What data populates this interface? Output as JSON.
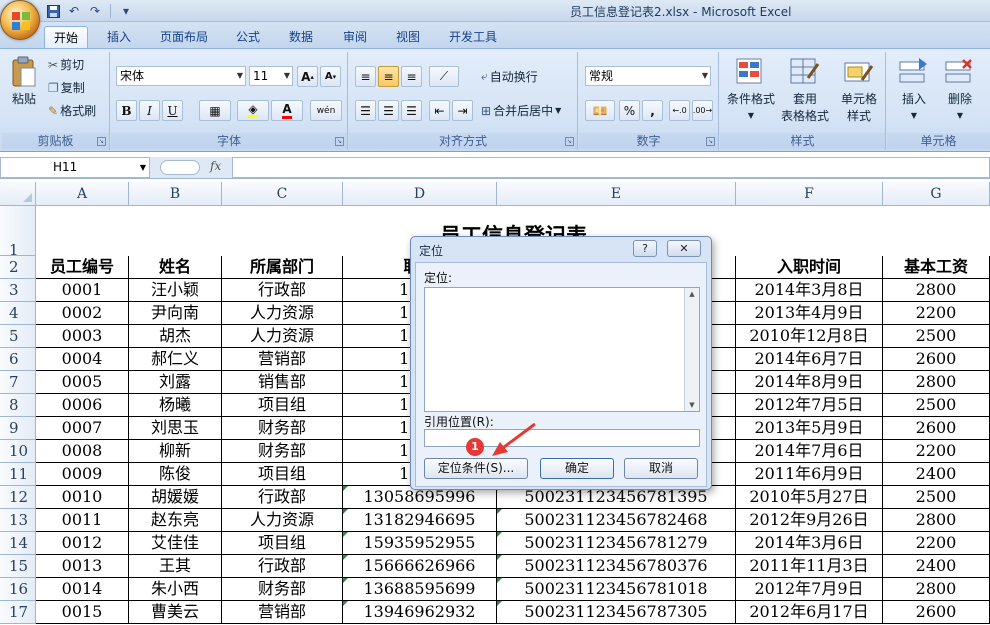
{
  "window": {
    "title": "员工信息登记表2.xlsx - Microsoft Excel"
  },
  "ribbon_tabs": [
    "开始",
    "插入",
    "页面布局",
    "公式",
    "数据",
    "审阅",
    "视图",
    "开发工具"
  ],
  "clipboard": {
    "paste": "粘贴",
    "cut": "剪切",
    "copy": "复制",
    "format_painter": "格式刷",
    "label": "剪贴板"
  },
  "font": {
    "name": "宋体",
    "size": "11",
    "label": "字体",
    "bold": "B",
    "italic": "I",
    "underline": "U",
    "grow": "A",
    "shrink": "A",
    "fill_color": "#ffff00",
    "font_color": "#ff0000",
    "pinyin": "wén"
  },
  "alignment": {
    "wrap": "自动换行",
    "merge": "合并后居中",
    "label": "对齐方式"
  },
  "number": {
    "format": "常规",
    "percent": "%",
    "comma": ",",
    "label": "数字"
  },
  "styles": {
    "conditional": "条件格式",
    "table_format": "套用\n表格格式",
    "cell_styles": "单元格\n样式",
    "label": "样式"
  },
  "cells": {
    "insert": "插入",
    "delete": "删除",
    "label": "单元格"
  },
  "formula_bar": {
    "name_box": "H11",
    "fx": "fx"
  },
  "columns": [
    "A",
    "B",
    "C",
    "D",
    "E",
    "F",
    "G"
  ],
  "sheet": {
    "title": "员工信息登记表",
    "headers": [
      "员工编号",
      "姓名",
      "所属部门",
      "联系",
      "",
      "入职时间",
      "基本工资"
    ],
    "rows": [
      [
        "0001",
        "汪小颖",
        "行政部",
        "1331",
        "",
        "2014年3月8日",
        "2800"
      ],
      [
        "0002",
        "尹向南",
        "人力资源",
        "1055",
        "",
        "2013年4月9日",
        "2200"
      ],
      [
        "0003",
        "胡杰",
        "人力资源",
        "1454",
        "",
        "2010年12月8日",
        "2500"
      ],
      [
        "0004",
        "郝仁义",
        "营销部",
        "1801",
        "",
        "2014年6月7日",
        "2600"
      ],
      [
        "0005",
        "刘露",
        "销售部",
        "1568",
        "",
        "2014年8月9日",
        "2800"
      ],
      [
        "0006",
        "杨曦",
        "项目组",
        "1584",
        "",
        "2012年7月5日",
        "2500"
      ],
      [
        "0007",
        "刘思玉",
        "财务部",
        "1367",
        "",
        "2013年5月9日",
        "2600"
      ],
      [
        "0008",
        "柳新",
        "财务部",
        "1358",
        "",
        "2014年7月6日",
        "2200"
      ],
      [
        "0009",
        "陈俊",
        "项目组",
        "1694",
        "",
        "2011年6月9日",
        "2400"
      ],
      [
        "0010",
        "胡媛媛",
        "行政部",
        "13058695996",
        "500231123456781395",
        "2010年5月27日",
        "2500"
      ],
      [
        "0011",
        "赵东亮",
        "人力资源",
        "13182946695",
        "500231123456782468",
        "2012年9月26日",
        "2800"
      ],
      [
        "0012",
        "艾佳佳",
        "项目组",
        "15935952955",
        "500231123456781279",
        "2014年3月6日",
        "2200"
      ],
      [
        "0013",
        "王其",
        "行政部",
        "15666626966",
        "500231123456780376",
        "2011年11月3日",
        "2400"
      ],
      [
        "0014",
        "朱小西",
        "财务部",
        "13688595699",
        "500231123456781018",
        "2012年7月9日",
        "2800"
      ],
      [
        "0015",
        "曹美云",
        "营销部",
        "13946962932",
        "500231123456787305",
        "2012年6月17日",
        "2600"
      ]
    ],
    "row_numbers": [
      "1",
      "2",
      "3",
      "4",
      "5",
      "6",
      "7",
      "8",
      "9",
      "10",
      "11",
      "12",
      "13",
      "14",
      "15",
      "16",
      "17"
    ]
  },
  "dialog": {
    "title": "定位",
    "help": "?",
    "close": "✕",
    "goto_label": "定位:",
    "reference_label": "引用位置(R):",
    "special_button": "定位条件(S)...",
    "ok_button": "确定",
    "cancel_button": "取消",
    "marker": "1",
    "marker_color": "#e53935"
  }
}
